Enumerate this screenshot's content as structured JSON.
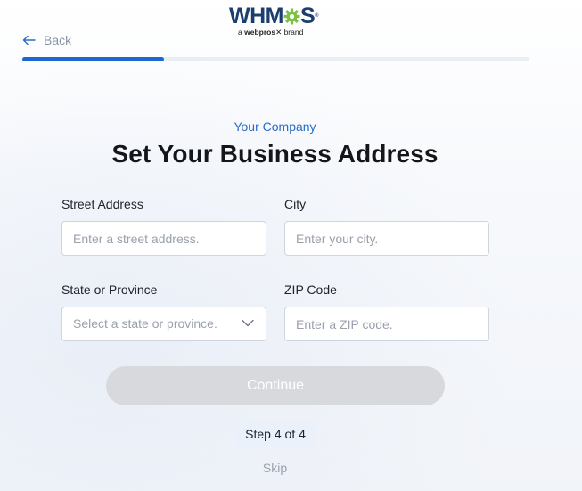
{
  "brand": {
    "logo_text_before": "WHM",
    "logo_text_after": "S",
    "logo_registered": "®",
    "tagline_prefix": "a",
    "tagline_brand": "webpros",
    "tagline_suffix": "brand",
    "logo_color": "#1b3e6f",
    "gear_color": "#7cc142",
    "gear_icon": "gear-icon"
  },
  "nav": {
    "back_label": "Back",
    "back_icon": "arrow-left-icon"
  },
  "progress": {
    "fraction": 0.28,
    "fill_color": "#1e66d0"
  },
  "header": {
    "eyebrow": "Your Company",
    "title": "Set Your Business Address"
  },
  "form": {
    "street": {
      "label": "Street Address",
      "placeholder": "Enter a street address.",
      "value": ""
    },
    "city": {
      "label": "City",
      "placeholder": "Enter your city.",
      "value": ""
    },
    "state": {
      "label": "State or Province",
      "selected": "Select a state or province.",
      "icon": "chevron-down-icon"
    },
    "zip": {
      "label": "ZIP Code",
      "placeholder": "Enter a ZIP code.",
      "value": ""
    }
  },
  "actions": {
    "continue_label": "Continue",
    "continue_disabled": true,
    "step_label": "Step 4 of 4",
    "skip_label": "Skip"
  }
}
